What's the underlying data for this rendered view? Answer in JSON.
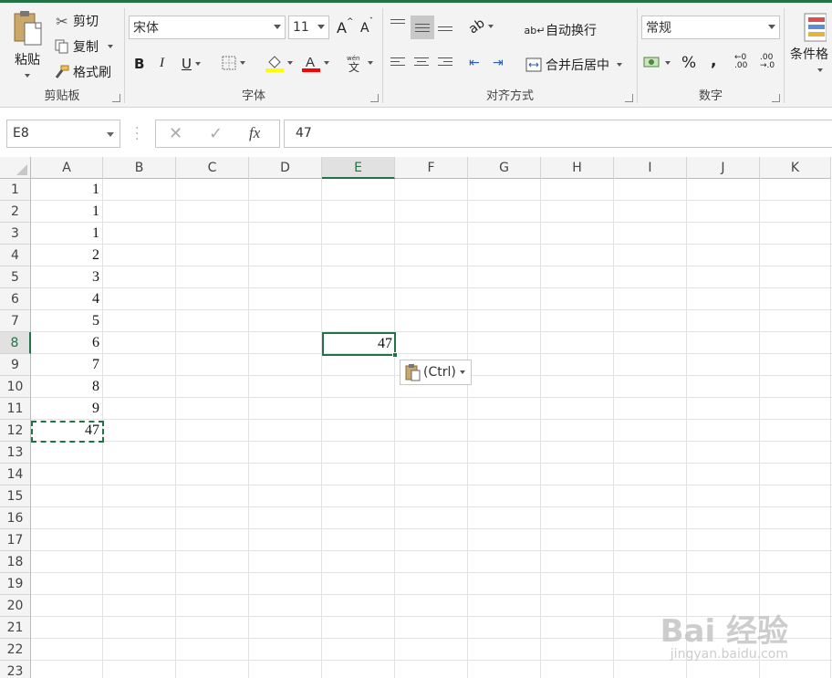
{
  "clipboard": {
    "paste": "粘贴",
    "cut": "剪切",
    "copy": "复制",
    "format_painter": "格式刷",
    "label": "剪贴板"
  },
  "font": {
    "name": "宋体",
    "size": "11",
    "label": "字体",
    "bold": "B",
    "italic": "I",
    "underline": "U",
    "grow": "A",
    "shrink": "A"
  },
  "alignment": {
    "wrap": "自动换行",
    "merge": "合并后居中",
    "label": "对齐方式"
  },
  "number": {
    "format": "常规",
    "label": "数字",
    "percent": "%",
    "comma": ","
  },
  "styles": {
    "conditional": "条件格"
  },
  "formula_bar": {
    "name_box": "E8",
    "value": "47",
    "fx": "fx"
  },
  "columns": [
    "A",
    "B",
    "C",
    "D",
    "E",
    "F",
    "G",
    "H",
    "I",
    "J",
    "K"
  ],
  "selected_column": "E",
  "rows": [
    "1",
    "2",
    "3",
    "4",
    "5",
    "6",
    "7",
    "8",
    "9",
    "10",
    "11",
    "12",
    "13",
    "14",
    "15",
    "16",
    "17",
    "18",
    "19",
    "20",
    "21",
    "22",
    "23"
  ],
  "selected_row": "8",
  "column_a_values": [
    "1",
    "1",
    "1",
    "2",
    "3",
    "4",
    "5",
    "6",
    "7",
    "8",
    "9",
    "47"
  ],
  "active_cell": {
    "ref": "E8",
    "value": "47"
  },
  "paste_options": {
    "label": "(Ctrl)"
  },
  "watermark": {
    "brand": "Bai  经验",
    "url": "jingyan.baidu.com"
  },
  "colors": {
    "accent": "#217346",
    "fill_highlight": "#ffff00",
    "font_color": "#ff0000"
  }
}
